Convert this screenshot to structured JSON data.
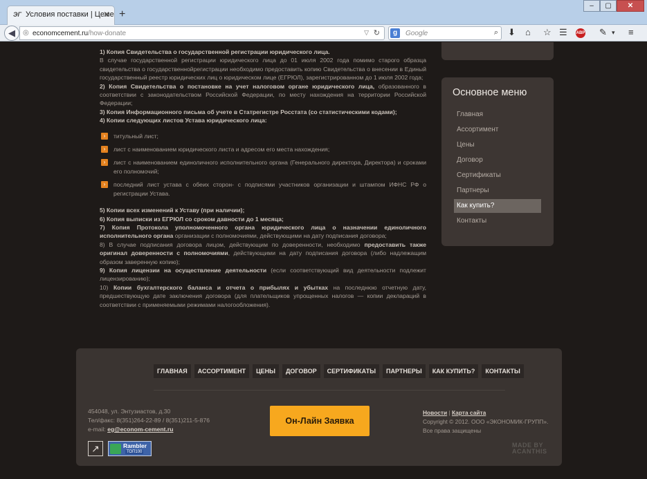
{
  "browser": {
    "tab_title": "Условия поставки | Цемен...",
    "new_tab": "+",
    "url_domain": "economcement.ru",
    "url_path": "/how-donate",
    "search_placeholder": "Google",
    "window_buttons": [
      "–",
      "▢",
      "✕"
    ]
  },
  "content": {
    "p1_title": "1) Копия Свидетельства о государственной регистрации юридического лица.",
    "p1_text": "В случае государственной регистрации юридического лица до 01 июля 2002 года помимо старого образца свидетельства о государственнойрегистрации необходимо предоставить копию Свидетельства о внесении в Единый государственный реестр юридических лиц о юридическом лице (ЕГРЮЛ), зарегистрированном до 1 июля 2002 года;",
    "p2_title": "2) Копия Свидетельства о постановке на учет налоговом органе юридического лица,",
    "p2_text": " образованного в соответствии с законодательством Российской Федерации, по месту нахождения на территории Российской Федерации;",
    "p3_title": "3) Копия Информационного письма об учете в Статрегистре Росстата (со статистическими кодами);",
    "p4_title": "4) Копии следующих листов Устава юридического лица:",
    "bullets": [
      "титульный лист;",
      "лист с наименованием юридического листа и адресом его места нахождения;",
      "лист с наименованием единоличного исполнительного органа (Генерального директора, Директора) и сроками его полномочий;",
      "последний лист устава с обеих сторон- с подписями участников организации и штампом ИФНС РФ о регистрации Устава."
    ],
    "p5_title": "5) Копии  всех изменений к Уставу (при наличии);",
    "p6_title": "6) Копия выписки из ЕГРЮЛ со сроком давности до 1 месяца;",
    "p7_title": "7) Копия Протокола уполномоченного органа юридического лица о назначении единоличного исполнительного органа",
    "p7_text": " организации с полномочиями, действующими на дату подписания договора;",
    "p8_a": "8) В случае подписания договора лицом, действующим по доверенности, необходимо ",
    "p8_b": "предоставить также оригинал доверенности с полномочиями",
    "p8_c": ", действующими на дату подписания договора (либо надлежащим образом заверенную копию);",
    "p9_title": "9) Копия лицензии на осуществление деятельности",
    "p9_text": " (если соответствующий вид деятельности подлежит лицензированию);",
    "p10_a": "10) ",
    "p10_b": "Копии бухгалтерского баланса и отчета о прибылях и убытках",
    "p10_c": " на последнюю отчетную дату, предшествующую дате заключения договора (для плательщиков упрощенных налогов — копии деклараций в соответствии с применяемыми режимами налогообложения)."
  },
  "sidebar": {
    "title": "Основное меню",
    "items": [
      {
        "label": "Главная"
      },
      {
        "label": "Ассортимент"
      },
      {
        "label": "Цены"
      },
      {
        "label": "Договор"
      },
      {
        "label": "Сертификаты"
      },
      {
        "label": "Партнеры"
      },
      {
        "label": "Как купить?"
      },
      {
        "label": "Контакты"
      }
    ],
    "active": "Как купить?"
  },
  "footer": {
    "nav": [
      {
        "label": "ГЛАВНАЯ"
      },
      {
        "label": "АССОРТИМЕНТ"
      },
      {
        "label": "ЦЕНЫ"
      },
      {
        "label": "ДОГОВОР"
      },
      {
        "label": "СЕРТИФИКАТЫ"
      },
      {
        "label": "ПАРТНЕРЫ"
      },
      {
        "label": "КАК КУПИТЬ?"
      },
      {
        "label": "КОНТАКТЫ"
      }
    ],
    "address": "454048, ул. Энтузиастов, д.30",
    "phone": "Тел/факс: 8(351)264-22-89 / 8(351)211-5-876",
    "email_label": "e-mail: ",
    "email": "eg@econom-cement.ru",
    "order_button": "Он-Лайн Заявка",
    "news_link": "Новости",
    "sep": " | ",
    "map_link": "Карта сайта",
    "copyright": "Copyright © 2012. ООО «ЭКОНОМИК-ГРУПП».",
    "rights": "Все права защищены",
    "rambler_title": "Rambler",
    "rambler_sub": "ТОП100",
    "madeby_1": "MADE BY",
    "madeby_2": "ACANTHIS"
  }
}
